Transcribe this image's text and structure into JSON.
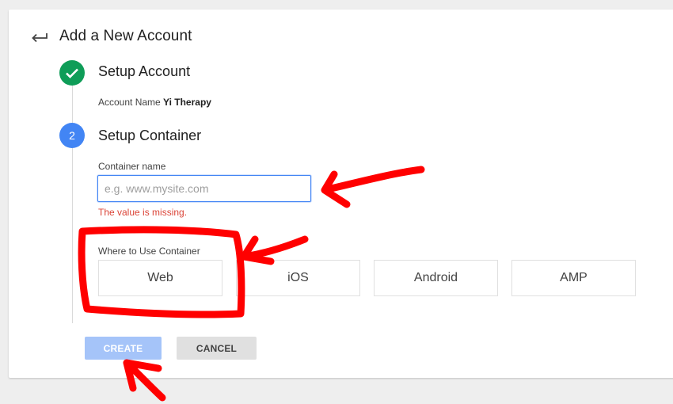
{
  "header": {
    "back_icon": "back-arrow-icon",
    "title": "Add a New Account"
  },
  "steps": [
    {
      "status": "complete",
      "icon": "checkmark-icon",
      "title": "Setup Account",
      "detail_label": "Account Name",
      "detail_value": "Yi Therapy"
    },
    {
      "status": "active",
      "number": "2",
      "title": "Setup Container"
    }
  ],
  "form": {
    "container_name_label": "Container name",
    "container_name_value": "",
    "container_name_placeholder": "e.g. www.mysite.com",
    "error_message": "The value is missing.",
    "where_to_use_label": "Where to Use Container",
    "platform_options": [
      "Web",
      "iOS",
      "Android",
      "AMP"
    ]
  },
  "actions": {
    "create_label": "CREATE",
    "cancel_label": "CANCEL"
  },
  "colors": {
    "step_complete": "#0f9d58",
    "step_active": "#4285f4",
    "error": "#db4437",
    "create_button": "#a5c4f9",
    "annotation_red": "#ff0000"
  }
}
